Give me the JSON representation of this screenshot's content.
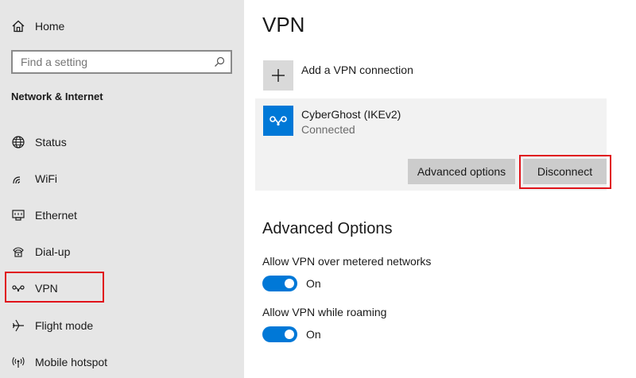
{
  "sidebar": {
    "home_label": "Home",
    "search": {
      "placeholder": "Find a setting",
      "value": ""
    },
    "section_title": "Network & Internet",
    "items": [
      {
        "label": "Status",
        "icon": "globe-icon"
      },
      {
        "label": "WiFi",
        "icon": "wifi-icon"
      },
      {
        "label": "Ethernet",
        "icon": "ethernet-icon"
      },
      {
        "label": "Dial-up",
        "icon": "dialup-icon"
      },
      {
        "label": "VPN",
        "icon": "vpn-icon",
        "selected": true
      },
      {
        "label": "Flight mode",
        "icon": "airplane-icon"
      },
      {
        "label": "Mobile hotspot",
        "icon": "hotspot-icon"
      }
    ]
  },
  "main": {
    "title": "VPN",
    "add_connection_label": "Add a VPN connection",
    "connection": {
      "name": "CyberGhost (IKEv2)",
      "status": "Connected",
      "advanced_button": "Advanced options",
      "disconnect_button": "Disconnect"
    },
    "advanced": {
      "heading": "Advanced Options",
      "options": [
        {
          "label": "Allow VPN over metered networks",
          "state": "On",
          "enabled": true
        },
        {
          "label": "Allow VPN while roaming",
          "state": "On",
          "enabled": true
        }
      ]
    }
  },
  "colors": {
    "accent": "#0078d7",
    "sidebar_bg": "#e6e6e6",
    "highlight": "#e0131a",
    "button_bg": "#cccccc"
  }
}
